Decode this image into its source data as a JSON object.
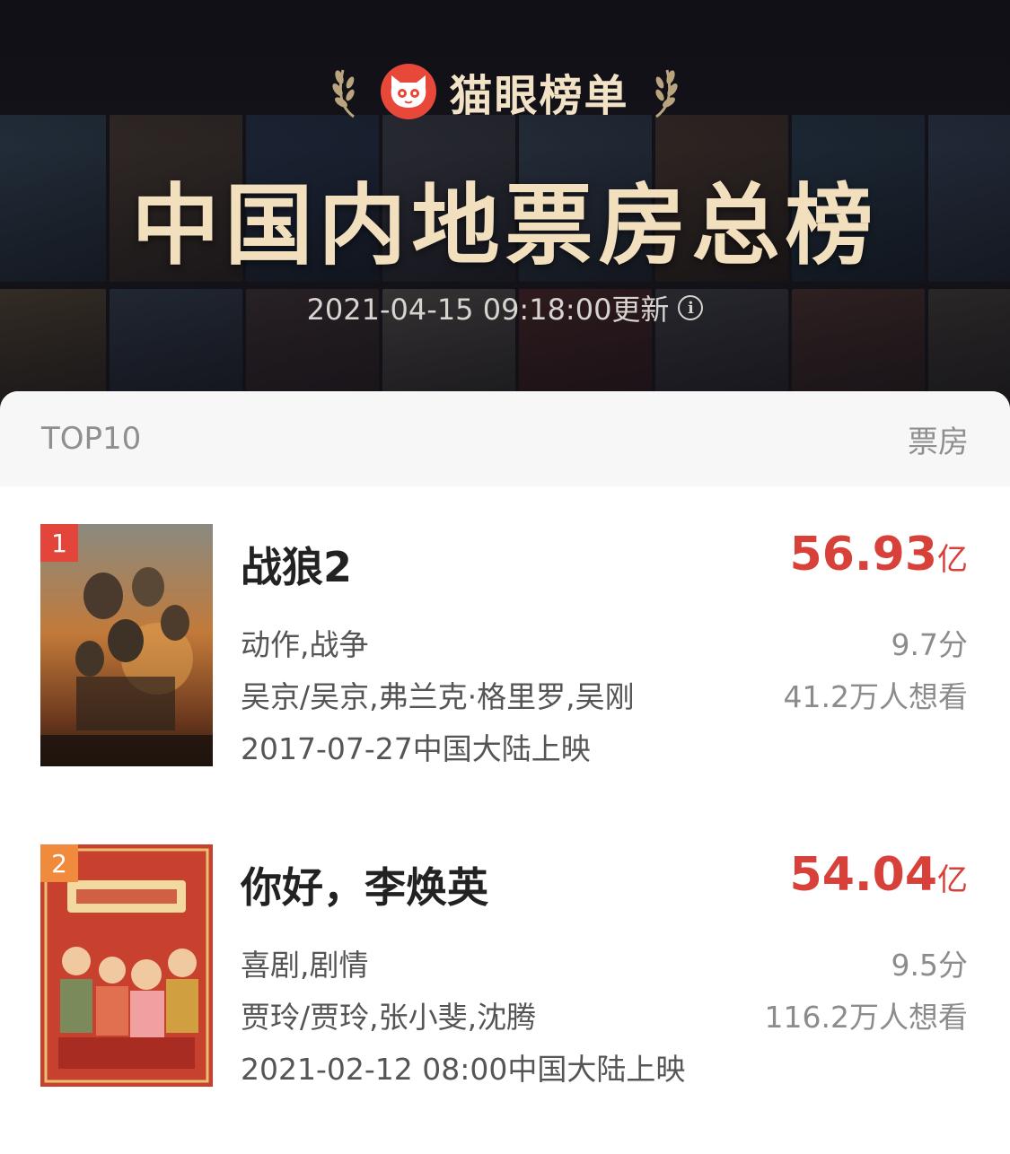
{
  "header": {
    "brand_name": "猫眼榜单",
    "title": "中国内地票房总榜",
    "update_text": "2021-04-15 09:18:00更新",
    "accent_color": "#f1dfbe",
    "logo_color": "#e8483a"
  },
  "list_header": {
    "left_label": "TOP10",
    "right_label": "票房"
  },
  "movies": [
    {
      "rank": "1",
      "title": "战狼2",
      "box_office_value": "56.93",
      "box_office_unit": "亿",
      "genres": "动作,战争",
      "people": "吴京/吴京,弗兰克·格里罗,吴刚",
      "release": "2017-07-27中国大陆上映",
      "score": "9.7分",
      "wish": "41.2万人想看",
      "rank_color": "#e4453b"
    },
    {
      "rank": "2",
      "title": "你好，李焕英",
      "box_office_value": "54.04",
      "box_office_unit": "亿",
      "genres": "喜剧,剧情",
      "people": "贾玲/贾玲,张小斐,沈腾",
      "release": "2021-02-12 08:00中国大陆上映",
      "score": "9.5分",
      "wish": "116.2万人想看",
      "rank_color": "#f08a3c"
    }
  ],
  "colors": {
    "price_red": "#d8403a",
    "header_bg": "#17161c"
  }
}
